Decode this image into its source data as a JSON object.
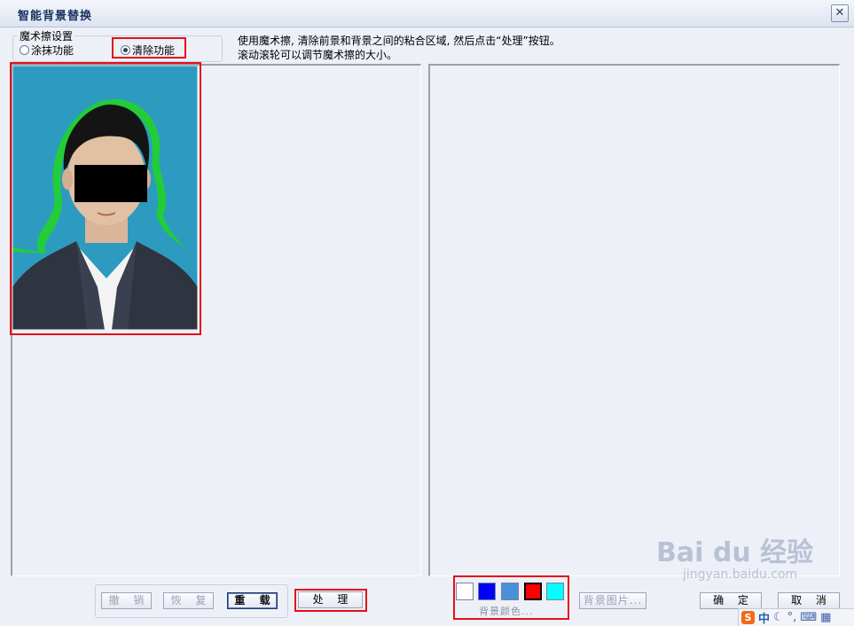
{
  "window": {
    "title": "智能背景替换",
    "close_glyph": "✕"
  },
  "magic_eraser": {
    "legend": "魔术擦设置",
    "options": [
      {
        "label": "涂抹功能",
        "selected": false
      },
      {
        "label": "清除功能",
        "selected": true
      }
    ]
  },
  "instructions": {
    "line1": "使用魔术擦, 清除前景和背景之间的粘合区域, 然后点击“处理”按钮。",
    "line2": "滚动滚轮可以调节魔术擦的大小。"
  },
  "buttons": {
    "undo": "撤 销",
    "redo": "恢 复",
    "reload": "重 载",
    "process": "处 理",
    "bg_image": "背景图片...",
    "ok": "确 定",
    "cancel": "取 消"
  },
  "background_color": {
    "label": "背景颜色...",
    "swatches": [
      {
        "name": "white",
        "color": "#ffffff"
      },
      {
        "name": "blue",
        "color": "#0000ff"
      },
      {
        "name": "light-blue",
        "color": "#4a90d9"
      },
      {
        "name": "red",
        "color": "#ff0000",
        "selected": true
      },
      {
        "name": "cyan",
        "color": "#00ffff"
      }
    ]
  },
  "watermark": {
    "text": "Bai du 经验",
    "sub": "jingyan.baidu.com"
  },
  "tray": {
    "ime_logo": "S",
    "ime_mode": "中"
  },
  "colors": {
    "highlight_red": "#e3101b",
    "photo_bg": "#2d9bc0",
    "mask_green": "#22d12a"
  }
}
